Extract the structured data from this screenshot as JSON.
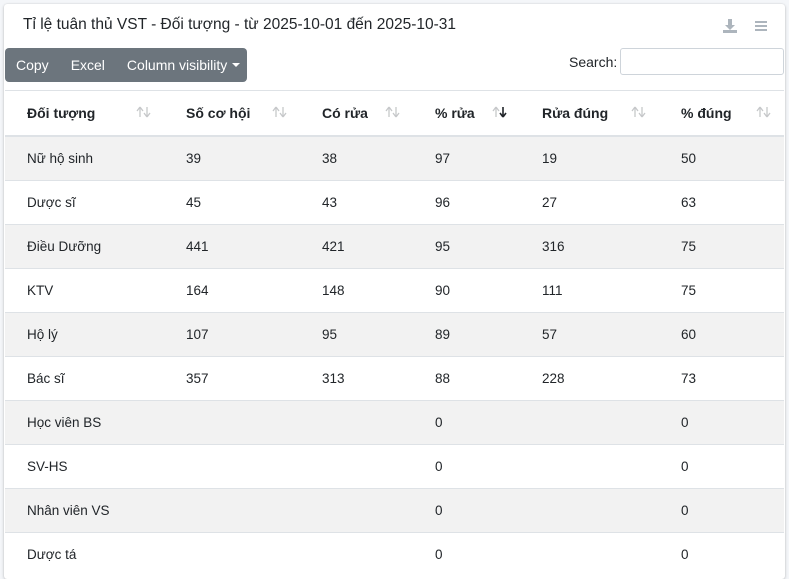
{
  "header": {
    "title": "Tỉ lệ tuân thủ VST - Đối tượng - từ 2025-10-01 đến 2025-10-31"
  },
  "toolbar": {
    "copy_label": "Copy",
    "excel_label": "Excel",
    "column_visibility_label": "Column visibility"
  },
  "search": {
    "label": "Search:",
    "value": ""
  },
  "table": {
    "columns": [
      "Đối tượng",
      "Số cơ hội",
      "Có rửa",
      "% rửa",
      "Rửa đúng",
      "% đúng"
    ],
    "sorted_column": "% rửa",
    "sort_direction": "descending",
    "rows": [
      [
        "Nữ hộ sinh",
        "39",
        "38",
        "97",
        "19",
        "50"
      ],
      [
        "Dược sĩ",
        "45",
        "43",
        "96",
        "27",
        "63"
      ],
      [
        "Điều Dưỡng",
        "441",
        "421",
        "95",
        "316",
        "75"
      ],
      [
        "KTV",
        "164",
        "148",
        "90",
        "111",
        "75"
      ],
      [
        "Hộ lý",
        "107",
        "95",
        "89",
        "57",
        "60"
      ],
      [
        "Bác sĩ",
        "357",
        "313",
        "88",
        "228",
        "73"
      ],
      [
        "Học viên BS",
        "",
        "",
        "0",
        "",
        "0"
      ],
      [
        "SV-HS",
        "",
        "",
        "0",
        "",
        "0"
      ],
      [
        "Nhân viên VS",
        "",
        "",
        "0",
        "",
        "0"
      ],
      [
        "Dược tá",
        "",
        "",
        "0",
        "",
        "0"
      ]
    ]
  },
  "colors": {
    "button_bg": "#6c757d",
    "stripe": "#f2f2f2",
    "border": "#dee2e6"
  }
}
